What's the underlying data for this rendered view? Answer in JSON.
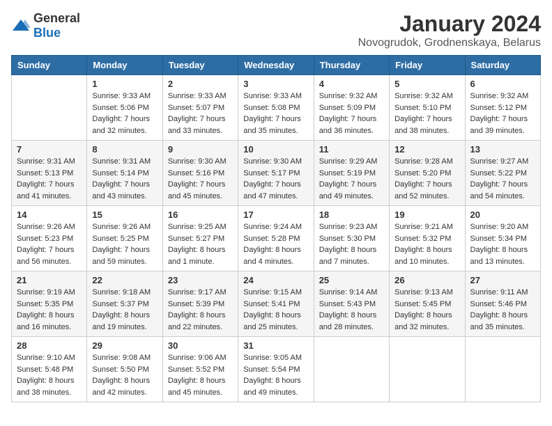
{
  "header": {
    "logo_general": "General",
    "logo_blue": "Blue",
    "main_title": "January 2024",
    "subtitle": "Novogrudok, Grodnenskaya, Belarus"
  },
  "days_of_week": [
    "Sunday",
    "Monday",
    "Tuesday",
    "Wednesday",
    "Thursday",
    "Friday",
    "Saturday"
  ],
  "weeks": [
    [
      {
        "day": "",
        "info": ""
      },
      {
        "day": "1",
        "info": "Sunrise: 9:33 AM\nSunset: 5:06 PM\nDaylight: 7 hours\nand 32 minutes."
      },
      {
        "day": "2",
        "info": "Sunrise: 9:33 AM\nSunset: 5:07 PM\nDaylight: 7 hours\nand 33 minutes."
      },
      {
        "day": "3",
        "info": "Sunrise: 9:33 AM\nSunset: 5:08 PM\nDaylight: 7 hours\nand 35 minutes."
      },
      {
        "day": "4",
        "info": "Sunrise: 9:32 AM\nSunset: 5:09 PM\nDaylight: 7 hours\nand 36 minutes."
      },
      {
        "day": "5",
        "info": "Sunrise: 9:32 AM\nSunset: 5:10 PM\nDaylight: 7 hours\nand 38 minutes."
      },
      {
        "day": "6",
        "info": "Sunrise: 9:32 AM\nSunset: 5:12 PM\nDaylight: 7 hours\nand 39 minutes."
      }
    ],
    [
      {
        "day": "7",
        "info": "Sunrise: 9:31 AM\nSunset: 5:13 PM\nDaylight: 7 hours\nand 41 minutes."
      },
      {
        "day": "8",
        "info": "Sunrise: 9:31 AM\nSunset: 5:14 PM\nDaylight: 7 hours\nand 43 minutes."
      },
      {
        "day": "9",
        "info": "Sunrise: 9:30 AM\nSunset: 5:16 PM\nDaylight: 7 hours\nand 45 minutes."
      },
      {
        "day": "10",
        "info": "Sunrise: 9:30 AM\nSunset: 5:17 PM\nDaylight: 7 hours\nand 47 minutes."
      },
      {
        "day": "11",
        "info": "Sunrise: 9:29 AM\nSunset: 5:19 PM\nDaylight: 7 hours\nand 49 minutes."
      },
      {
        "day": "12",
        "info": "Sunrise: 9:28 AM\nSunset: 5:20 PM\nDaylight: 7 hours\nand 52 minutes."
      },
      {
        "day": "13",
        "info": "Sunrise: 9:27 AM\nSunset: 5:22 PM\nDaylight: 7 hours\nand 54 minutes."
      }
    ],
    [
      {
        "day": "14",
        "info": "Sunrise: 9:26 AM\nSunset: 5:23 PM\nDaylight: 7 hours\nand 56 minutes."
      },
      {
        "day": "15",
        "info": "Sunrise: 9:26 AM\nSunset: 5:25 PM\nDaylight: 7 hours\nand 59 minutes."
      },
      {
        "day": "16",
        "info": "Sunrise: 9:25 AM\nSunset: 5:27 PM\nDaylight: 8 hours\nand 1 minute."
      },
      {
        "day": "17",
        "info": "Sunrise: 9:24 AM\nSunset: 5:28 PM\nDaylight: 8 hours\nand 4 minutes."
      },
      {
        "day": "18",
        "info": "Sunrise: 9:23 AM\nSunset: 5:30 PM\nDaylight: 8 hours\nand 7 minutes."
      },
      {
        "day": "19",
        "info": "Sunrise: 9:21 AM\nSunset: 5:32 PM\nDaylight: 8 hours\nand 10 minutes."
      },
      {
        "day": "20",
        "info": "Sunrise: 9:20 AM\nSunset: 5:34 PM\nDaylight: 8 hours\nand 13 minutes."
      }
    ],
    [
      {
        "day": "21",
        "info": "Sunrise: 9:19 AM\nSunset: 5:35 PM\nDaylight: 8 hours\nand 16 minutes."
      },
      {
        "day": "22",
        "info": "Sunrise: 9:18 AM\nSunset: 5:37 PM\nDaylight: 8 hours\nand 19 minutes."
      },
      {
        "day": "23",
        "info": "Sunrise: 9:17 AM\nSunset: 5:39 PM\nDaylight: 8 hours\nand 22 minutes."
      },
      {
        "day": "24",
        "info": "Sunrise: 9:15 AM\nSunset: 5:41 PM\nDaylight: 8 hours\nand 25 minutes."
      },
      {
        "day": "25",
        "info": "Sunrise: 9:14 AM\nSunset: 5:43 PM\nDaylight: 8 hours\nand 28 minutes."
      },
      {
        "day": "26",
        "info": "Sunrise: 9:13 AM\nSunset: 5:45 PM\nDaylight: 8 hours\nand 32 minutes."
      },
      {
        "day": "27",
        "info": "Sunrise: 9:11 AM\nSunset: 5:46 PM\nDaylight: 8 hours\nand 35 minutes."
      }
    ],
    [
      {
        "day": "28",
        "info": "Sunrise: 9:10 AM\nSunset: 5:48 PM\nDaylight: 8 hours\nand 38 minutes."
      },
      {
        "day": "29",
        "info": "Sunrise: 9:08 AM\nSunset: 5:50 PM\nDaylight: 8 hours\nand 42 minutes."
      },
      {
        "day": "30",
        "info": "Sunrise: 9:06 AM\nSunset: 5:52 PM\nDaylight: 8 hours\nand 45 minutes."
      },
      {
        "day": "31",
        "info": "Sunrise: 9:05 AM\nSunset: 5:54 PM\nDaylight: 8 hours\nand 49 minutes."
      },
      {
        "day": "",
        "info": ""
      },
      {
        "day": "",
        "info": ""
      },
      {
        "day": "",
        "info": ""
      }
    ]
  ]
}
